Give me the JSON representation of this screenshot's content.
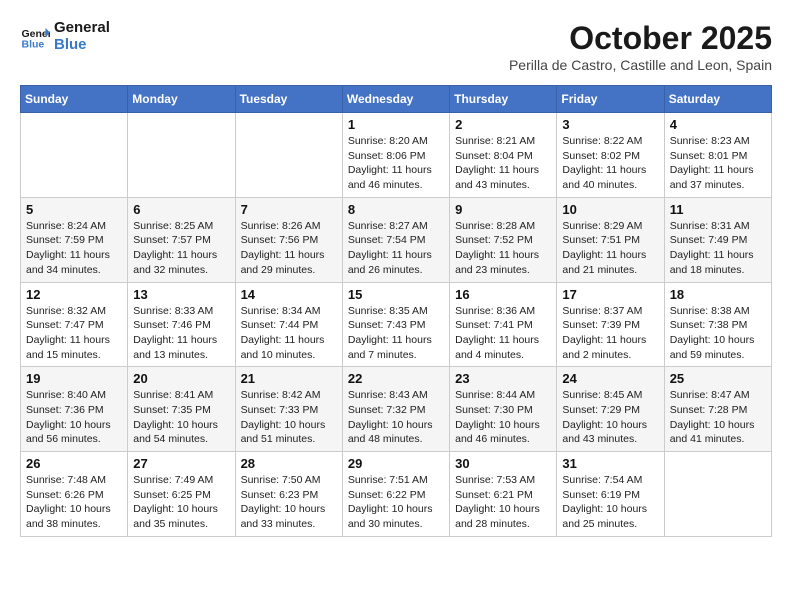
{
  "logo": {
    "line1": "General",
    "line2": "Blue"
  },
  "title": "October 2025",
  "subtitle": "Perilla de Castro, Castille and Leon, Spain",
  "days_of_week": [
    "Sunday",
    "Monday",
    "Tuesday",
    "Wednesday",
    "Thursday",
    "Friday",
    "Saturday"
  ],
  "weeks": [
    [
      {
        "day": "",
        "info": ""
      },
      {
        "day": "",
        "info": ""
      },
      {
        "day": "",
        "info": ""
      },
      {
        "day": "1",
        "info": "Sunrise: 8:20 AM\nSunset: 8:06 PM\nDaylight: 11 hours and 46 minutes."
      },
      {
        "day": "2",
        "info": "Sunrise: 8:21 AM\nSunset: 8:04 PM\nDaylight: 11 hours and 43 minutes."
      },
      {
        "day": "3",
        "info": "Sunrise: 8:22 AM\nSunset: 8:02 PM\nDaylight: 11 hours and 40 minutes."
      },
      {
        "day": "4",
        "info": "Sunrise: 8:23 AM\nSunset: 8:01 PM\nDaylight: 11 hours and 37 minutes."
      }
    ],
    [
      {
        "day": "5",
        "info": "Sunrise: 8:24 AM\nSunset: 7:59 PM\nDaylight: 11 hours and 34 minutes."
      },
      {
        "day": "6",
        "info": "Sunrise: 8:25 AM\nSunset: 7:57 PM\nDaylight: 11 hours and 32 minutes."
      },
      {
        "day": "7",
        "info": "Sunrise: 8:26 AM\nSunset: 7:56 PM\nDaylight: 11 hours and 29 minutes."
      },
      {
        "day": "8",
        "info": "Sunrise: 8:27 AM\nSunset: 7:54 PM\nDaylight: 11 hours and 26 minutes."
      },
      {
        "day": "9",
        "info": "Sunrise: 8:28 AM\nSunset: 7:52 PM\nDaylight: 11 hours and 23 minutes."
      },
      {
        "day": "10",
        "info": "Sunrise: 8:29 AM\nSunset: 7:51 PM\nDaylight: 11 hours and 21 minutes."
      },
      {
        "day": "11",
        "info": "Sunrise: 8:31 AM\nSunset: 7:49 PM\nDaylight: 11 hours and 18 minutes."
      }
    ],
    [
      {
        "day": "12",
        "info": "Sunrise: 8:32 AM\nSunset: 7:47 PM\nDaylight: 11 hours and 15 minutes."
      },
      {
        "day": "13",
        "info": "Sunrise: 8:33 AM\nSunset: 7:46 PM\nDaylight: 11 hours and 13 minutes."
      },
      {
        "day": "14",
        "info": "Sunrise: 8:34 AM\nSunset: 7:44 PM\nDaylight: 11 hours and 10 minutes."
      },
      {
        "day": "15",
        "info": "Sunrise: 8:35 AM\nSunset: 7:43 PM\nDaylight: 11 hours and 7 minutes."
      },
      {
        "day": "16",
        "info": "Sunrise: 8:36 AM\nSunset: 7:41 PM\nDaylight: 11 hours and 4 minutes."
      },
      {
        "day": "17",
        "info": "Sunrise: 8:37 AM\nSunset: 7:39 PM\nDaylight: 11 hours and 2 minutes."
      },
      {
        "day": "18",
        "info": "Sunrise: 8:38 AM\nSunset: 7:38 PM\nDaylight: 10 hours and 59 minutes."
      }
    ],
    [
      {
        "day": "19",
        "info": "Sunrise: 8:40 AM\nSunset: 7:36 PM\nDaylight: 10 hours and 56 minutes."
      },
      {
        "day": "20",
        "info": "Sunrise: 8:41 AM\nSunset: 7:35 PM\nDaylight: 10 hours and 54 minutes."
      },
      {
        "day": "21",
        "info": "Sunrise: 8:42 AM\nSunset: 7:33 PM\nDaylight: 10 hours and 51 minutes."
      },
      {
        "day": "22",
        "info": "Sunrise: 8:43 AM\nSunset: 7:32 PM\nDaylight: 10 hours and 48 minutes."
      },
      {
        "day": "23",
        "info": "Sunrise: 8:44 AM\nSunset: 7:30 PM\nDaylight: 10 hours and 46 minutes."
      },
      {
        "day": "24",
        "info": "Sunrise: 8:45 AM\nSunset: 7:29 PM\nDaylight: 10 hours and 43 minutes."
      },
      {
        "day": "25",
        "info": "Sunrise: 8:47 AM\nSunset: 7:28 PM\nDaylight: 10 hours and 41 minutes."
      }
    ],
    [
      {
        "day": "26",
        "info": "Sunrise: 7:48 AM\nSunset: 6:26 PM\nDaylight: 10 hours and 38 minutes."
      },
      {
        "day": "27",
        "info": "Sunrise: 7:49 AM\nSunset: 6:25 PM\nDaylight: 10 hours and 35 minutes."
      },
      {
        "day": "28",
        "info": "Sunrise: 7:50 AM\nSunset: 6:23 PM\nDaylight: 10 hours and 33 minutes."
      },
      {
        "day": "29",
        "info": "Sunrise: 7:51 AM\nSunset: 6:22 PM\nDaylight: 10 hours and 30 minutes."
      },
      {
        "day": "30",
        "info": "Sunrise: 7:53 AM\nSunset: 6:21 PM\nDaylight: 10 hours and 28 minutes."
      },
      {
        "day": "31",
        "info": "Sunrise: 7:54 AM\nSunset: 6:19 PM\nDaylight: 10 hours and 25 minutes."
      },
      {
        "day": "",
        "info": ""
      }
    ]
  ]
}
